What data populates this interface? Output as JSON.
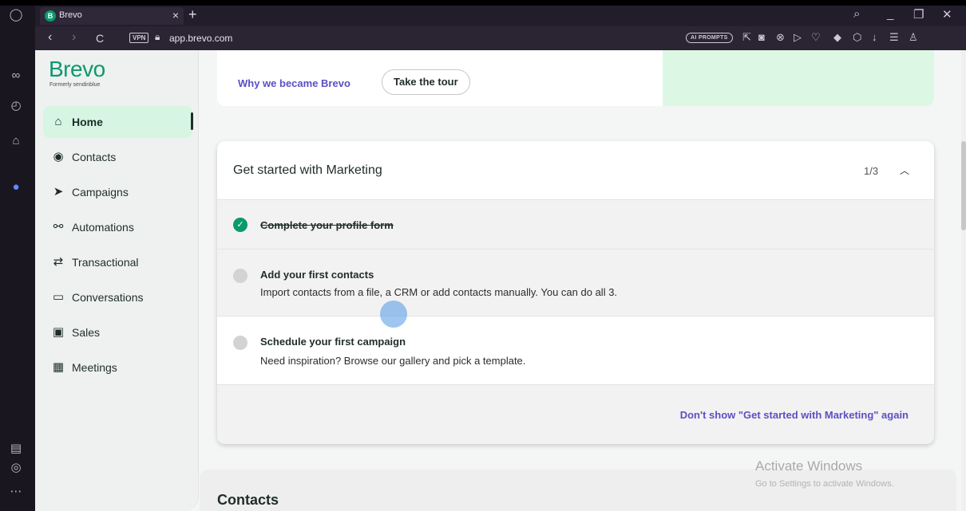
{
  "browser": {
    "tab_title": "Brevo",
    "tab_favicon": "B",
    "tab_close": "×",
    "new_tab": "+",
    "vpn_badge": "VPN",
    "url": "app.brevo.com",
    "ai_prompts": "AI PROMPTS",
    "nav_back": "‹",
    "nav_forward": "›",
    "nav_reload": "C"
  },
  "sidebar": {
    "brand": "Brevo",
    "brand_sub": "Formerly sendinblue",
    "items": [
      {
        "label": "Home",
        "icon": "home-icon",
        "active": true
      },
      {
        "label": "Contacts",
        "icon": "contacts-icon"
      },
      {
        "label": "Campaigns",
        "icon": "send-icon"
      },
      {
        "label": "Automations",
        "icon": "automation-icon"
      },
      {
        "label": "Transactional",
        "icon": "transfer-icon"
      },
      {
        "label": "Conversations",
        "icon": "chat-icon"
      },
      {
        "label": "Sales",
        "icon": "kanban-icon"
      },
      {
        "label": "Meetings",
        "icon": "calendar-icon"
      }
    ]
  },
  "top_card": {
    "why_link": "Why we became Brevo",
    "tour_button": "Take the tour"
  },
  "marketing": {
    "title": "Get started with Marketing",
    "progress": "1/3",
    "steps": [
      {
        "title": "Complete your profile form",
        "desc": "",
        "done": true
      },
      {
        "title": "Add your first contacts",
        "desc": "Import contacts from a file, a CRM or add contacts manually. You can do all 3.",
        "done": false
      },
      {
        "title": "Schedule your first campaign",
        "desc": "Need inspiration? Browse our gallery and pick a template.",
        "done": false
      }
    ],
    "dont_show": "Don't show \"Get started with Marketing\" again"
  },
  "contacts_section": {
    "title": "Contacts"
  },
  "watermark": {
    "line1": "Activate Windows",
    "line2": "Go to Settings to activate Windows."
  },
  "colors": {
    "brand_green": "#0b996e",
    "active_nav_bg": "#d6f6e3",
    "link_purple": "#5b50c4"
  }
}
